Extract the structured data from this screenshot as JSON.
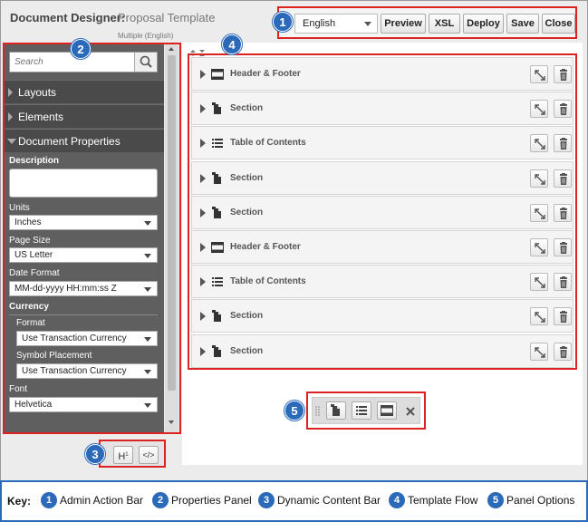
{
  "header": {
    "app_title": "Document Designer:",
    "template_name": "Proposal Template",
    "template_language": "Multiple (English)"
  },
  "admin_bar": {
    "language": "English",
    "buttons": [
      "Preview",
      "XSL",
      "Deploy",
      "Save",
      "Close"
    ]
  },
  "callouts": [
    "1",
    "2",
    "3",
    "4",
    "5"
  ],
  "properties_panel": {
    "search_placeholder": "Search",
    "sections": [
      "Layouts",
      "Elements",
      "Document Properties"
    ],
    "description_label": "Description",
    "units_label": "Units",
    "units_value": "Inches",
    "page_size_label": "Page Size",
    "page_size_value": "US Letter",
    "date_format_label": "Date Format",
    "date_format_value": "MM-dd-yyyy HH:mm:ss Z",
    "currency_label": "Currency",
    "format_label": "Format",
    "format_value": "Use Transaction Currency",
    "symbol_label": "Symbol Placement",
    "symbol_value": "Use Transaction Currency",
    "font_label": "Font",
    "font_value": "Helvetica"
  },
  "dynamic_bar": {
    "heading_button": "H",
    "heading_superscript": "1",
    "code_button": "</>"
  },
  "template_flow": {
    "rows": [
      {
        "label": "Header & Footer",
        "icon": "header-footer-icon"
      },
      {
        "label": "Section",
        "icon": "section-icon"
      },
      {
        "label": "Table of Contents",
        "icon": "toc-icon"
      },
      {
        "label": "Section",
        "icon": "section-icon"
      },
      {
        "label": "Section",
        "icon": "section-icon"
      },
      {
        "label": "Header & Footer",
        "icon": "header-footer-icon"
      },
      {
        "label": "Table of Contents",
        "icon": "toc-icon"
      },
      {
        "label": "Section",
        "icon": "section-icon"
      },
      {
        "label": "Section",
        "icon": "section-icon"
      }
    ]
  },
  "key": {
    "title": "Key:",
    "items": [
      {
        "num": "1",
        "label": "Admin Action Bar"
      },
      {
        "num": "2",
        "label": "Properties Panel"
      },
      {
        "num": "3",
        "label": "Dynamic Content Bar"
      },
      {
        "num": "4",
        "label": "Template Flow"
      },
      {
        "num": "5",
        "label": "Panel Options"
      }
    ]
  },
  "colors": {
    "callout_blue": "#2b6ab8",
    "highlight_red": "#dd2222",
    "panel_gray": "#5f5f5f"
  }
}
